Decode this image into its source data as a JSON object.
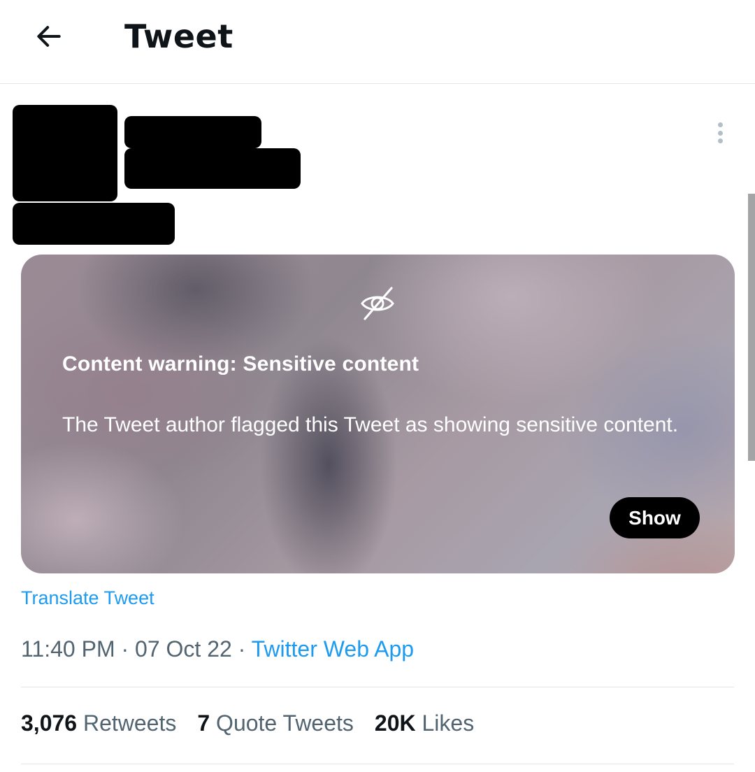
{
  "header": {
    "title": "Tweet",
    "back_icon": "arrow-left-icon"
  },
  "tweet": {
    "media": {
      "icon": "eye-off-icon",
      "warning_title": "Content warning: Sensitive content",
      "warning_text": "The Tweet author flagged this Tweet as showing sensitive content.",
      "show_label": "Show"
    },
    "translate_label": "Translate Tweet",
    "time": "11:40 PM",
    "date": "07 Oct 22",
    "separator": "·",
    "source": "Twitter Web App",
    "stats": {
      "retweets_count": "3,076",
      "retweets_label": "Retweets",
      "quotes_count": "7",
      "quotes_label": "Quote Tweets",
      "likes_count": "20K",
      "likes_label": "Likes"
    }
  },
  "colors": {
    "link": "#1d9bf0",
    "text_primary": "#0f1419",
    "text_secondary": "#536471"
  }
}
